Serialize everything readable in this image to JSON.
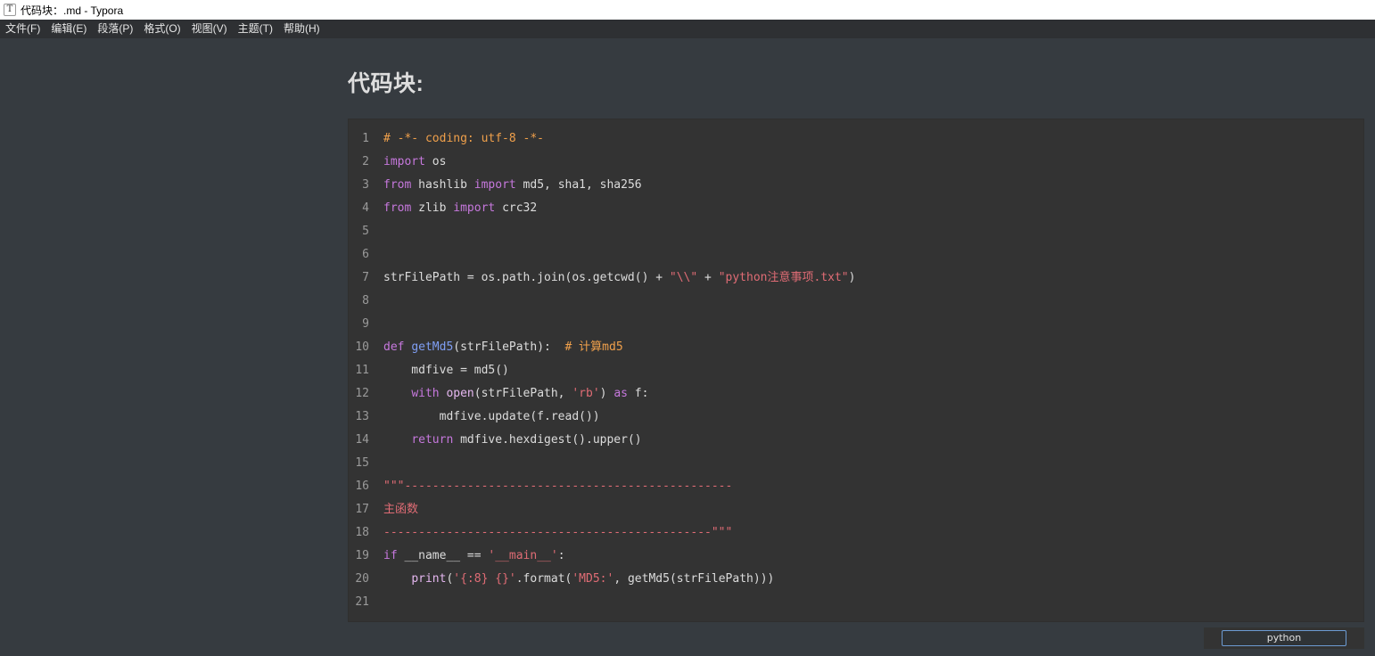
{
  "window": {
    "icon_glyph": "T",
    "title": "代码块：.md - Typora"
  },
  "menu": [
    {
      "label": "文件(F)"
    },
    {
      "label": "编辑(E)"
    },
    {
      "label": "段落(P)"
    },
    {
      "label": "格式(O)"
    },
    {
      "label": "视图(V)"
    },
    {
      "label": "主题(T)"
    },
    {
      "label": "帮助(H)"
    }
  ],
  "document": {
    "heading": "代码块:"
  },
  "code_block": {
    "language": "python",
    "lines": [
      {
        "no": "1",
        "tokens": [
          {
            "t": "# -*- coding: utf-8 -*-",
            "c": "#f0a04b"
          }
        ]
      },
      {
        "no": "2",
        "tokens": [
          {
            "t": "import",
            "c": "#c678dd"
          },
          {
            "t": " os",
            "c": "#dcdcdc"
          }
        ]
      },
      {
        "no": "3",
        "tokens": [
          {
            "t": "from",
            "c": "#c678dd"
          },
          {
            "t": " hashlib ",
            "c": "#dcdcdc"
          },
          {
            "t": "import",
            "c": "#c678dd"
          },
          {
            "t": " md5, sha1, sha256",
            "c": "#dcdcdc"
          }
        ]
      },
      {
        "no": "4",
        "tokens": [
          {
            "t": "from",
            "c": "#c678dd"
          },
          {
            "t": " zlib ",
            "c": "#dcdcdc"
          },
          {
            "t": "import",
            "c": "#c678dd"
          },
          {
            "t": " crc32",
            "c": "#dcdcdc"
          }
        ]
      },
      {
        "no": "5",
        "tokens": []
      },
      {
        "no": "6",
        "tokens": []
      },
      {
        "no": "7",
        "tokens": [
          {
            "t": "strFilePath = os.path.join(os.getcwd() + ",
            "c": "#dcdcdc"
          },
          {
            "t": "\"\\\\\"",
            "c": "#e06c75"
          },
          {
            "t": " + ",
            "c": "#dcdcdc"
          },
          {
            "t": "\"python注意事项.txt\"",
            "c": "#e06c75"
          },
          {
            "t": ")",
            "c": "#dcdcdc"
          }
        ]
      },
      {
        "no": "8",
        "tokens": []
      },
      {
        "no": "9",
        "tokens": []
      },
      {
        "no": "10",
        "tokens": [
          {
            "t": "def",
            "c": "#c678dd"
          },
          {
            "t": " ",
            "c": "#dcdcdc"
          },
          {
            "t": "getMd5",
            "c": "#7f9ef3"
          },
          {
            "t": "(strFilePath):  ",
            "c": "#dcdcdc"
          },
          {
            "t": "# 计算md5",
            "c": "#f0a04b"
          }
        ]
      },
      {
        "no": "11",
        "tokens": [
          {
            "t": "    mdfive = md5()",
            "c": "#dcdcdc"
          }
        ]
      },
      {
        "no": "12",
        "tokens": [
          {
            "t": "    ",
            "c": "#dcdcdc"
          },
          {
            "t": "with",
            "c": "#c678dd"
          },
          {
            "t": " ",
            "c": "#dcdcdc"
          },
          {
            "t": "open",
            "c": "#e5b7f0"
          },
          {
            "t": "(strFilePath, ",
            "c": "#dcdcdc"
          },
          {
            "t": "'rb'",
            "c": "#e06c75"
          },
          {
            "t": ") ",
            "c": "#dcdcdc"
          },
          {
            "t": "as",
            "c": "#c678dd"
          },
          {
            "t": " f:",
            "c": "#dcdcdc"
          }
        ]
      },
      {
        "no": "13",
        "tokens": [
          {
            "t": "        mdfive.update(f.read())",
            "c": "#dcdcdc"
          }
        ]
      },
      {
        "no": "14",
        "tokens": [
          {
            "t": "    ",
            "c": "#dcdcdc"
          },
          {
            "t": "return",
            "c": "#c678dd"
          },
          {
            "t": " mdfive.hexdigest().upper()",
            "c": "#dcdcdc"
          }
        ]
      },
      {
        "no": "15",
        "tokens": []
      },
      {
        "no": "16",
        "tokens": [
          {
            "t": "\"\"\"-----------------------------------------------",
            "c": "#e06c75"
          }
        ]
      },
      {
        "no": "17",
        "tokens": [
          {
            "t": "主函数",
            "c": "#e06c75"
          }
        ]
      },
      {
        "no": "18",
        "tokens": [
          {
            "t": "-----------------------------------------------\"\"\"",
            "c": "#e06c75"
          }
        ]
      },
      {
        "no": "19",
        "tokens": [
          {
            "t": "if",
            "c": "#c678dd"
          },
          {
            "t": " __name__ == ",
            "c": "#dcdcdc"
          },
          {
            "t": "'__main__'",
            "c": "#e06c75"
          },
          {
            "t": ":",
            "c": "#dcdcdc"
          }
        ]
      },
      {
        "no": "20",
        "tokens": [
          {
            "t": "    ",
            "c": "#dcdcdc"
          },
          {
            "t": "print",
            "c": "#e5b7f0"
          },
          {
            "t": "(",
            "c": "#dcdcdc"
          },
          {
            "t": "'{:8} {}'",
            "c": "#e06c75"
          },
          {
            "t": ".format(",
            "c": "#dcdcdc"
          },
          {
            "t": "'MD5:'",
            "c": "#e06c75"
          },
          {
            "t": ", getMd5(strFilePath)))",
            "c": "#dcdcdc"
          }
        ]
      },
      {
        "no": "21",
        "tokens": []
      }
    ]
  },
  "colors": {
    "editor_bg": "#363b40",
    "code_bg": "#333333",
    "keyword": "#c678dd",
    "string": "#e06c75",
    "comment": "#f0a04b",
    "function_name": "#7f9ef3",
    "builtin": "#e5b7f0"
  }
}
